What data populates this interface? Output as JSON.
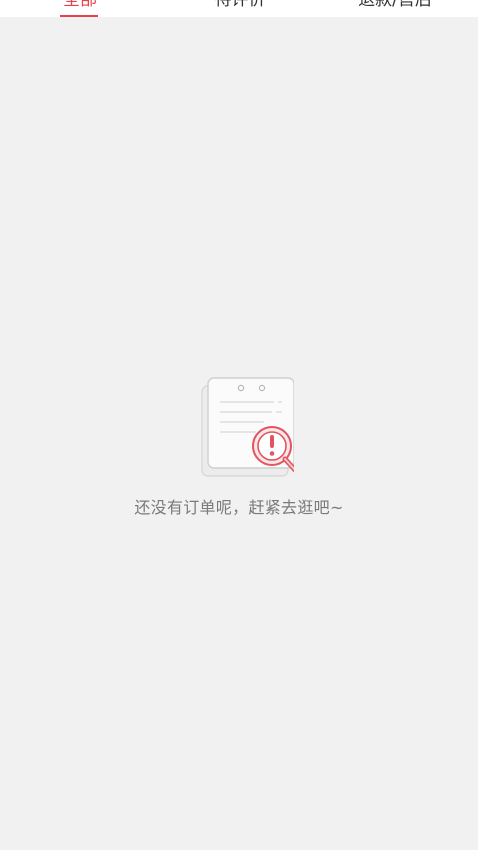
{
  "tabs": {
    "all": "全部",
    "pending": "待评价",
    "refund": "退款/售后"
  },
  "empty": {
    "message": "还没有订单呢，赶紧去逛吧~",
    "icon": "empty-orders-icon"
  },
  "colors": {
    "accent": "#e8414a",
    "background": "#f1f1f1"
  }
}
